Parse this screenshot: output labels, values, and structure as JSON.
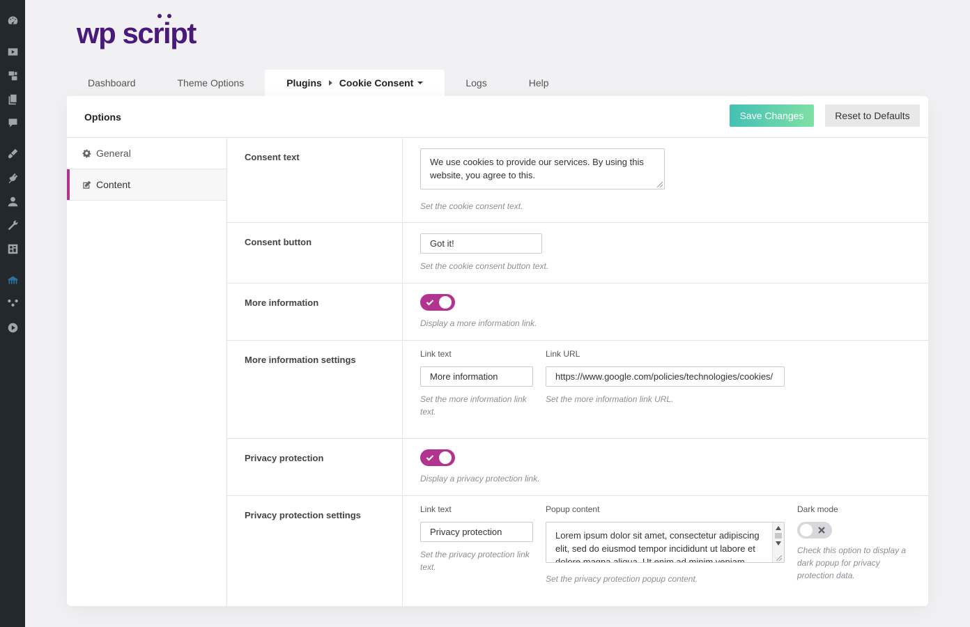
{
  "logo": {
    "text": "wp script"
  },
  "tabs": [
    {
      "label": "Dashboard"
    },
    {
      "label": "Theme Options"
    },
    {
      "label": "Plugins",
      "sub_label": "Cookie Consent",
      "active": true
    },
    {
      "label": "Logs"
    },
    {
      "label": "Help"
    }
  ],
  "card": {
    "title": "Options",
    "save_label": "Save Changes",
    "reset_label": "Reset to Defaults"
  },
  "side_nav": [
    {
      "label": "General",
      "icon": "gear-icon"
    },
    {
      "label": "Content",
      "icon": "edit-icon",
      "active": true
    }
  ],
  "rows": {
    "consent_text": {
      "label": "Consent text",
      "value": "We use cookies to provide our services. By using this website, you agree to this.",
      "desc": "Set the cookie consent text."
    },
    "consent_button": {
      "label": "Consent button",
      "value": "Got it!",
      "desc": "Set the cookie consent button text."
    },
    "more_info": {
      "label": "More information",
      "enabled": true,
      "desc": "Display a more information link."
    },
    "more_info_settings": {
      "label": "More information settings",
      "link_text_label": "Link text",
      "link_text_value": "More information",
      "link_text_desc": "Set the more information link text.",
      "link_url_label": "Link URL",
      "link_url_value": "https://www.google.com/policies/technologies/cookies/",
      "link_url_desc": "Set the more information link URL."
    },
    "privacy": {
      "label": "Privacy protection",
      "enabled": true,
      "desc": "Display a privacy protection link."
    },
    "privacy_settings": {
      "label": "Privacy protection settings",
      "link_text_label": "Link text",
      "link_text_value": "Privacy protection",
      "link_text_desc": "Set the privacy protection link text.",
      "popup_label": "Popup content",
      "popup_value": "Lorem ipsum dolor sit amet, consectetur adipiscing elit, sed do eiusmod tempor incididunt ut labore et dolore magna aliqua. Ut enim ad minim veniam,",
      "popup_desc": "Set the privacy protection popup content.",
      "dark_label": "Dark mode",
      "dark_enabled": false,
      "dark_desc": "Check this option to display a dark popup for privacy protection data."
    }
  },
  "colors": {
    "accent": "#b2348f",
    "logo": "#4a1a7a",
    "save_gradient_start": "#43c0b5",
    "save_gradient_end": "#7fe0a5",
    "wp_sidebar": "#23282d"
  }
}
